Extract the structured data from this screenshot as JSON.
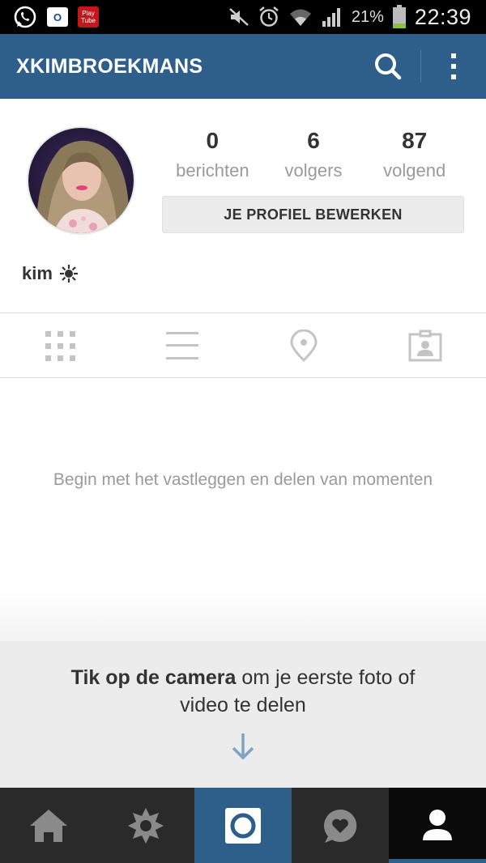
{
  "status_bar": {
    "icons": [
      "whatsapp-icon",
      "outlook-icon",
      "playtube-icon",
      "mute-icon",
      "alarm-icon",
      "wifi-icon",
      "signal-icon",
      "battery-icon"
    ],
    "outlook_label": "O",
    "playtube_label": "Play Tube",
    "battery": "21%",
    "time": "22:39"
  },
  "header": {
    "title": "XKIMBROEKMANS",
    "accent_color": "#2d5f8a"
  },
  "profile": {
    "stats": [
      {
        "value": "0",
        "label": "berichten"
      },
      {
        "value": "6",
        "label": "volgers"
      },
      {
        "value": "87",
        "label": "volgend"
      }
    ],
    "edit_button": "JE PROFIEL BEWERKEN",
    "name": "kim",
    "name_badge_icon": "sun-icon"
  },
  "tabs": [
    "grid-icon",
    "list-icon",
    "location-icon",
    "tagged-icon"
  ],
  "empty_state": {
    "message": "Begin met het vastleggen en delen van momenten"
  },
  "camera_hint": {
    "bold": "Tik op de camera",
    "rest": " om je eerste foto of video te delen"
  },
  "bottom_nav": [
    "home-icon",
    "explore-icon",
    "camera-icon",
    "activity-icon",
    "profile-icon"
  ]
}
